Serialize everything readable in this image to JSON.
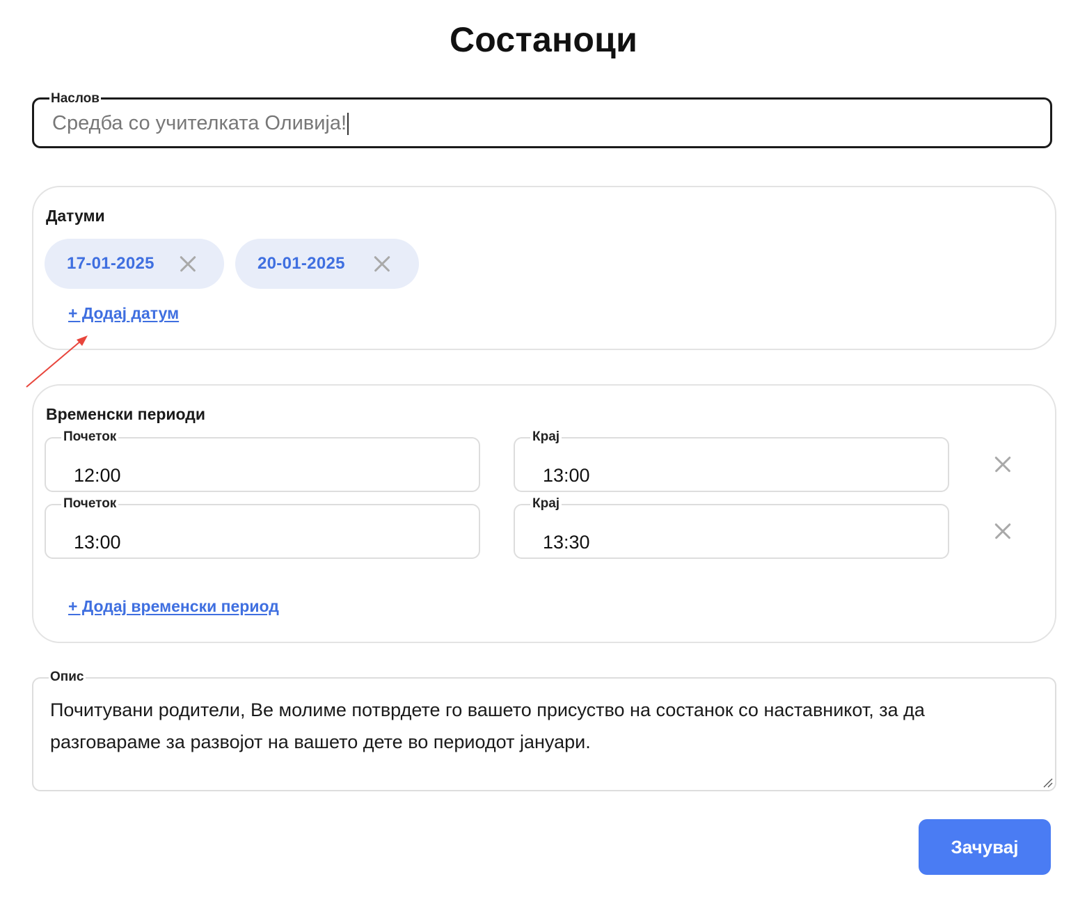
{
  "page": {
    "title": "Состаноци"
  },
  "title_field": {
    "label": "Наслов",
    "value": "Средба со учителката Оливија!"
  },
  "dates": {
    "heading": "Датуми",
    "chips": [
      {
        "label": "17-01-2025"
      },
      {
        "label": "20-01-2025"
      }
    ],
    "add_label": "+ Додај датум"
  },
  "time_periods": {
    "heading": "Временски периоди",
    "rows": [
      {
        "start_label": "Почеток",
        "start_value": "12:00",
        "end_label": "Крај",
        "end_value": "13:00"
      },
      {
        "start_label": "Почеток",
        "start_value": "13:00",
        "end_label": "Крај",
        "end_value": "13:30"
      }
    ],
    "add_label": "+ Додај временски период"
  },
  "description": {
    "label": "Опис",
    "value": "Почитувани родители, Ве молиме потврдете го вашето присуство на состанок со наставникот, за да разговараме за развојот на вашето дете во периодот јануари."
  },
  "actions": {
    "save_label": "Зачувај"
  },
  "colors": {
    "accent": "#4a7cf3",
    "chip_bg": "#e8edf9",
    "chip_text": "#3f6fe0",
    "annotation_arrow": "#e8453c"
  }
}
